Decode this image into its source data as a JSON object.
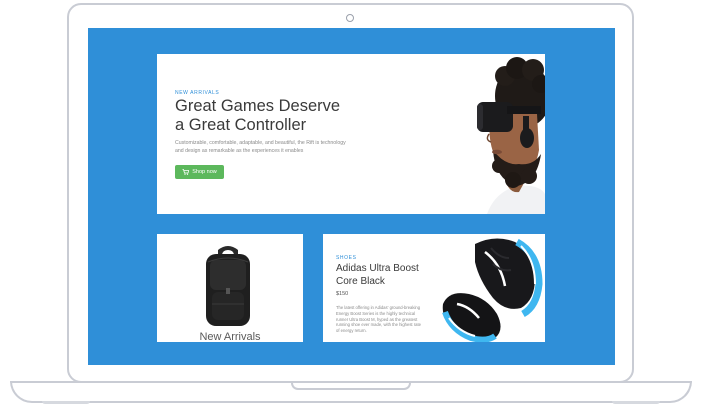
{
  "hero": {
    "eyebrow": "NEW ARRIVALS",
    "title_line1": "Great Games Deserve",
    "title_line2": "a Great Controller",
    "description": "Customizable, comfortable, adaptable, and beautiful, the Rift is technology and design as remarkable as the experiences it enables",
    "button_label": "Shop now",
    "button_icon": "cart-icon"
  },
  "card_left": {
    "title": "New Arrivals"
  },
  "card_right": {
    "eyebrow": "SHOES",
    "title_line1": "Adidas Ultra Boost",
    "title_line2": "Core Black",
    "price": "$150",
    "description": "The latest offering in Adidas' ground-breaking Energy Boost Series is the highly technical runner Ultra Boost M, hyped as the greatest running shoe ever made, with the highest rate of energy return."
  },
  "colors": {
    "screen_bg": "#2f8fd8",
    "accent": "#2f8fd8",
    "button": "#5cb85c"
  }
}
